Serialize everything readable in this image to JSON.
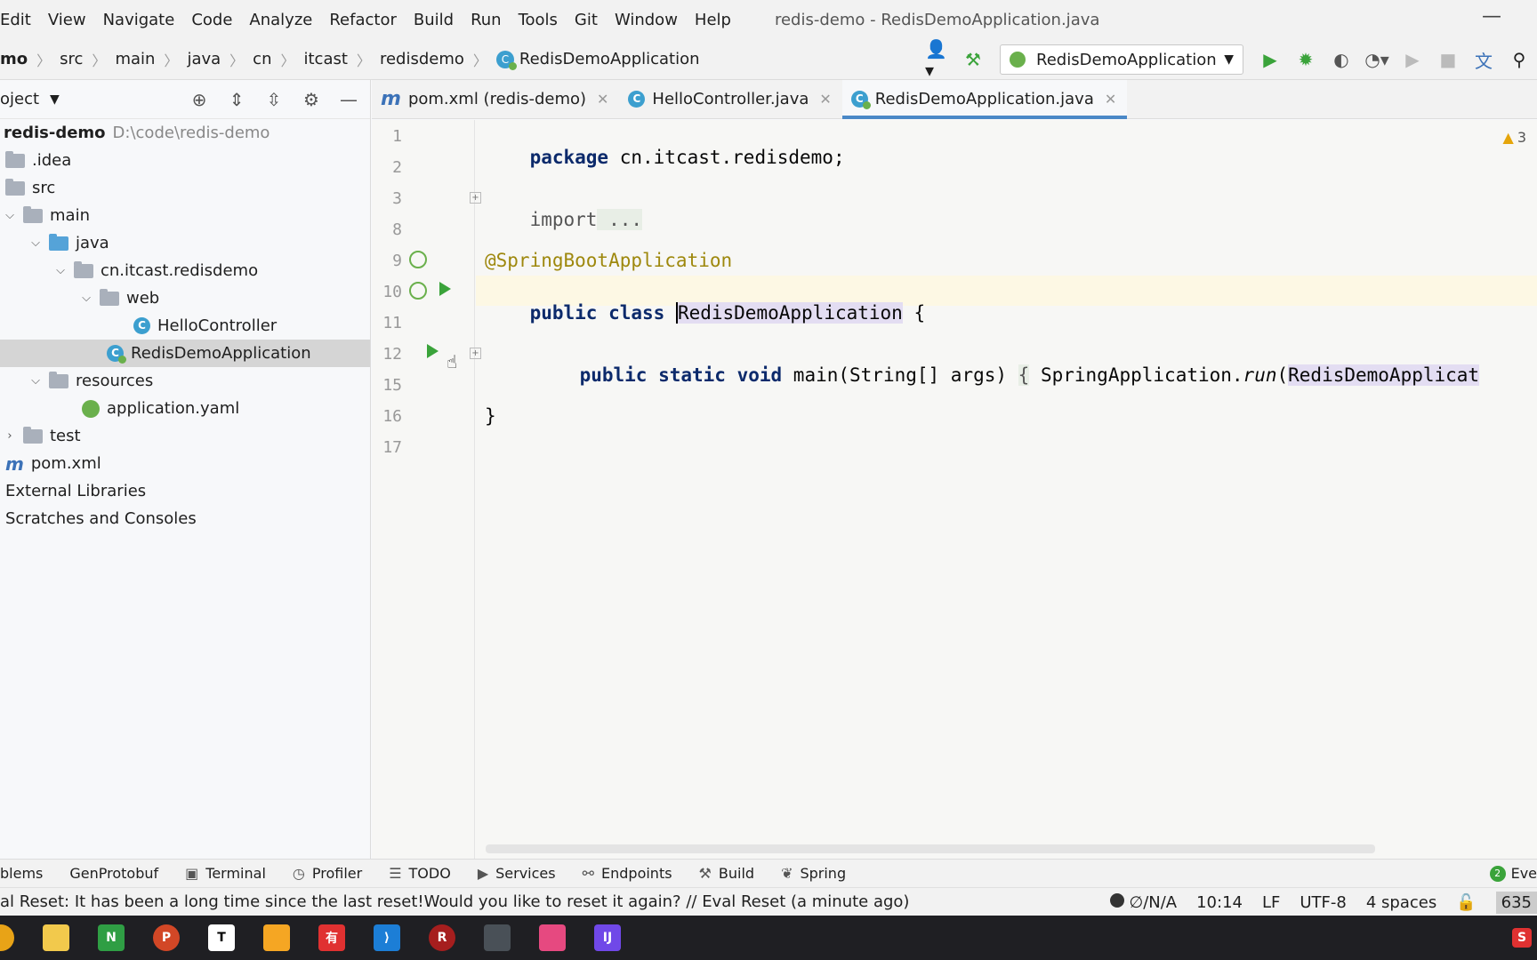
{
  "menubar": {
    "items": [
      "Edit",
      "View",
      "Navigate",
      "Code",
      "Analyze",
      "Refactor",
      "Build",
      "Run",
      "Tools",
      "Git",
      "Window",
      "Help"
    ],
    "title": "redis-demo - RedisDemoApplication.java"
  },
  "breadcrumb": {
    "items": [
      "mo",
      "src",
      "main",
      "java",
      "cn",
      "itcast",
      "redisdemo",
      "RedisDemoApplication"
    ]
  },
  "run_config": {
    "label": "RedisDemoApplication"
  },
  "project": {
    "header": "oject",
    "root_name": "redis-demo",
    "root_path": "D:\\code\\redis-demo",
    "tree": [
      {
        "label": ".idea"
      },
      {
        "label": "src"
      },
      {
        "label": "main"
      },
      {
        "label": "java"
      },
      {
        "label": "cn.itcast.redisdemo"
      },
      {
        "label": "web"
      },
      {
        "label": "HelloController"
      },
      {
        "label": "RedisDemoApplication"
      },
      {
        "label": "resources"
      },
      {
        "label": "application.yaml"
      },
      {
        "label": "test"
      },
      {
        "label": "pom.xml"
      },
      {
        "label": "External Libraries"
      },
      {
        "label": "Scratches and Consoles"
      }
    ]
  },
  "tabs": [
    {
      "label": "pom.xml (redis-demo)"
    },
    {
      "label": "HelloController.java"
    },
    {
      "label": "RedisDemoApplication.java"
    }
  ],
  "editor": {
    "warning_count": "3",
    "line_numbers": [
      "1",
      "2",
      "3",
      "8",
      "9",
      "10",
      "11",
      "12",
      "15",
      "16",
      "17"
    ],
    "code": {
      "l1_kw": "package",
      "l1_rest": " cn.itcast.redisdemo;",
      "l3_kw": "import",
      "l3_fold": " ...",
      "l9": "@SpringBootApplication",
      "l10_kw": "public class ",
      "l10_name": "RedisDemoApplication",
      "l10_rest": " {",
      "l12_kw": "public static void",
      "l12_rest": " main(String[] args) ",
      "l12_fold": "{",
      "l12_call": " SpringApplication.",
      "l12_run": "run",
      "l12_paren": "(",
      "l12_arg": "RedisDemoApplicat",
      "l16": "}"
    }
  },
  "tool_windows": [
    "blems",
    "GenProtobuf",
    "Terminal",
    "Profiler",
    "TODO",
    "Services",
    "Endpoints",
    "Build",
    "Spring"
  ],
  "events": {
    "badge": "2",
    "label": "Eve"
  },
  "status": {
    "message": "al Reset: It has been a long time since the last reset!Would you like to reset it again? // Eval Reset (a minute ago)",
    "vcs": "∅/N/A",
    "position": "10:14",
    "line_sep": "LF",
    "encoding": "UTF-8",
    "indent": "4 spaces",
    "memory": "635"
  },
  "colors": {
    "run_green": "#3aa33a",
    "tab_underline": "#4a88c7",
    "keyword": "#0c2a6b",
    "annotation": "#9e880d"
  }
}
